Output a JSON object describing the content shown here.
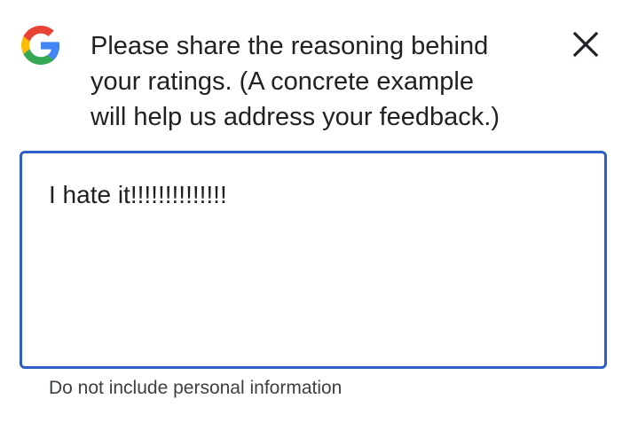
{
  "dialog": {
    "logo_icon": "google-g-icon",
    "prompt": "Please share the reasoning behind your ratings. (A concrete example will help us address your feedback.)",
    "prompt_lines": [
      "Please share the reasoning behind",
      "your ratings. (A concrete example",
      "will help us address your feedback.)"
    ],
    "close_icon": "close-icon",
    "feedback_input": {
      "value": "I hate it!!!!!!!!!!!!!!",
      "focused_border_color": "#2f5fc4"
    },
    "helper_text": "Do not include personal information"
  },
  "colors": {
    "google_blue": "#4285F4",
    "google_red": "#EA4335",
    "google_yellow": "#FBBC05",
    "google_green": "#34A853",
    "text": "#202124",
    "secondary_text": "#3c4043"
  }
}
